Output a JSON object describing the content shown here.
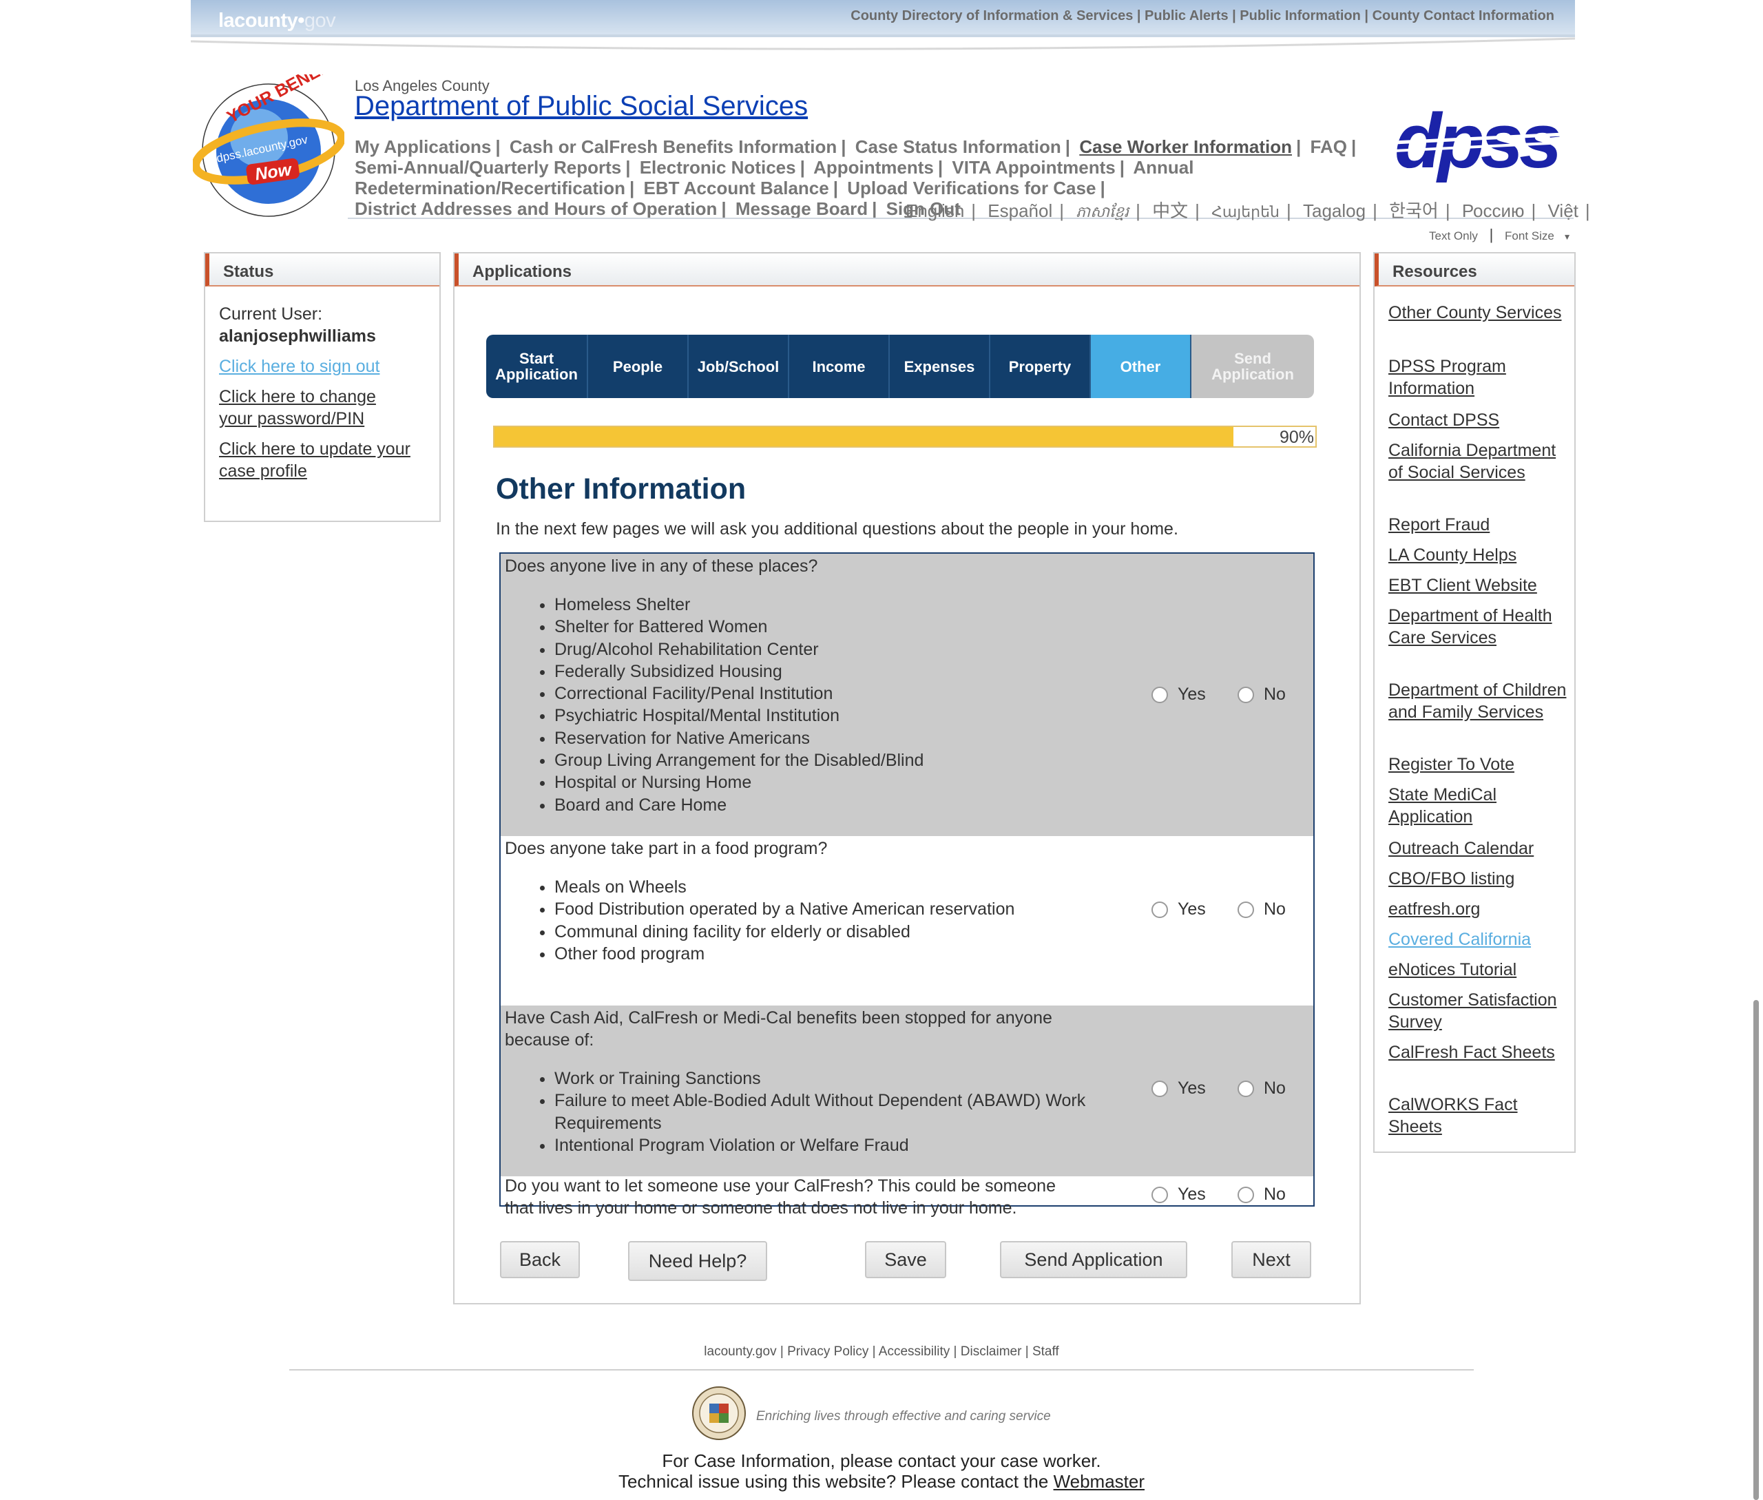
{
  "topbar": {
    "logo_main": "lacounty",
    "logo_gov": "gov",
    "links": [
      "County Directory of Information & Services",
      "Public Alerts",
      "Public Information",
      "County Contact Information"
    ]
  },
  "header": {
    "county": "Los Angeles County",
    "dept": "Department of Public Social Services",
    "badge_top": "YOUR BENEFITS",
    "badge_url": "dpss.lacounty.gov",
    "badge_now": "Now",
    "dpss_logo": "dpss",
    "nav": [
      {
        "label": "My Applications"
      },
      {
        "label": "Cash or CalFresh Benefits Information"
      },
      {
        "label": "Case Status Information"
      },
      {
        "label": "Case Worker Information"
      },
      {
        "label": "FAQ"
      },
      {
        "label": "Semi-Annual/Quarterly Reports"
      },
      {
        "label": "Electronic Notices"
      },
      {
        "label": "Appointments"
      },
      {
        "label": "VITA Appointments"
      },
      {
        "label": "Annual Redetermination/Recertification"
      },
      {
        "label": "EBT Account Balance"
      },
      {
        "label": "Upload Verifications for Case"
      },
      {
        "label": "District Addresses and Hours of Operation"
      },
      {
        "label": "Message Board"
      },
      {
        "label": "Sign Out"
      }
    ],
    "languages": [
      "English",
      "Español",
      "ភាសាខ្មែរ",
      "中文",
      "Հայերեն",
      "Tagalog",
      "한국어",
      "Россию",
      "Việt"
    ],
    "text_only": "Text Only",
    "font_size": "Font Size"
  },
  "status": {
    "title": "Status",
    "current_user_label": "Current User:",
    "username": "alanjosephwilliams",
    "sign_out": "Click here to sign out",
    "change_pw_1": "Click here to change",
    "change_pw_2": "your password/PIN",
    "update_1": "Click here to update your",
    "update_2": "case profile"
  },
  "applications": {
    "title": "Applications",
    "tabs": [
      {
        "l1": "Start",
        "l2": "Application"
      },
      {
        "l1": "People",
        "l2": ""
      },
      {
        "l1": "Job/School",
        "l2": ""
      },
      {
        "l1": "Income",
        "l2": ""
      },
      {
        "l1": "Expenses",
        "l2": ""
      },
      {
        "l1": "Property",
        "l2": ""
      },
      {
        "l1": "Other",
        "l2": ""
      },
      {
        "l1": "Send",
        "l2": "Application"
      }
    ],
    "progress_fraction": 0.9,
    "progress_label": "90%",
    "section_title": "Other Information",
    "intro": "In the next few pages we will ask you additional questions about the people in your home.",
    "yes": "Yes",
    "no": "No",
    "questions": [
      {
        "text": "Does anyone live in any of these places?",
        "items": [
          "Homeless Shelter",
          "Shelter for Battered Women",
          "Drug/Alcohol Rehabilitation Center",
          "Federally Subsidized Housing",
          "Correctional Facility/Penal Institution",
          "Psychiatric Hospital/Mental Institution",
          "Reservation for Native Americans",
          "Group Living Arrangement for the Disabled/Blind",
          "Hospital or Nursing Home",
          "Board and Care Home"
        ]
      },
      {
        "text": "Does anyone take part in a food program?",
        "items": [
          "Meals on Wheels",
          "Food Distribution operated by a Native American reservation",
          "Communal dining facility for elderly or disabled",
          "Other food program"
        ]
      },
      {
        "text_1": "Have Cash Aid, CalFresh or Medi-Cal benefits been stopped for anyone",
        "text_2": "because of:",
        "items": [
          "Work or Training Sanctions",
          "Failure to meet Able-Bodied Adult Without Dependent (ABAWD) Work Requirements",
          "Intentional Program Violation or Welfare Fraud"
        ]
      },
      {
        "text_1": "Do you want to let someone use your CalFresh? This could be someone",
        "text_2": "that lives in your home or someone that does not live in your home."
      }
    ],
    "buttons": {
      "back": "Back",
      "help": "Need Help?",
      "save": "Save",
      "send": "Send Application",
      "next": "Next"
    }
  },
  "resources": {
    "title": "Resources",
    "links": [
      "Other County Services",
      "DPSS Program Information",
      "Contact DPSS",
      "California Department of Social Services",
      "Report Fraud",
      "LA County Helps",
      "EBT Client Website",
      "Department of Health Care Services",
      "Department of Children and Family Services",
      "Register To Vote",
      "State MediCal Application",
      "Outreach Calendar",
      "CBO/FBO listing",
      "eatfresh.org",
      "Covered California",
      "eNotices Tutorial",
      "Customer Satisfaction Survey",
      "CalFresh Fact Sheets",
      "CalWORKS Fact Sheets"
    ]
  },
  "footer": {
    "links": [
      "lacounty.gov",
      "Privacy Policy",
      "Accessibility",
      "Disclaimer",
      "Staff"
    ],
    "tagline": "Enriching lives through effective and caring service",
    "case_info": "For Case Information, please contact your case worker.",
    "tech_prefix": "Technical issue using this website? Please contact the",
    "webmaster": "Webmaster"
  },
  "colors": {
    "nav_blue": "#123e6b",
    "active_tab": "#46ade4",
    "progress": "#f5c535",
    "title_blue": "#0b3fb4",
    "accent_red": "#c9512a"
  }
}
